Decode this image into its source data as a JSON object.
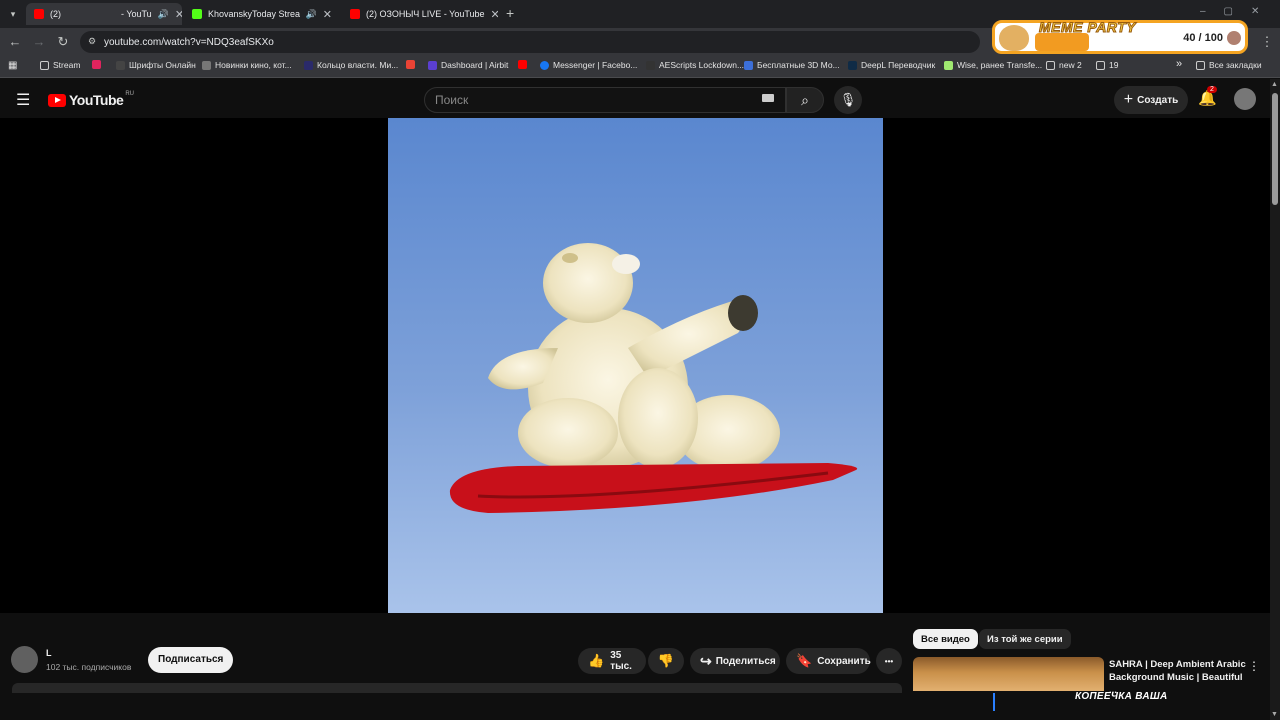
{
  "browser": {
    "tabs": [
      {
        "label": "(2)",
        "label2": "- YouTu",
        "color": "#ff0000",
        "active": true
      },
      {
        "label": "KhovanskyToday Stream - V",
        "color": "#53fc18",
        "active": false
      },
      {
        "label": "(2) ОЗОНЫЧ LIVE - YouTube",
        "color": "#ff0000",
        "active": false
      }
    ],
    "new_tab": "+",
    "url": "youtube.com/watch?v=NDQ3eafSKXo",
    "bookmarks": [
      {
        "label": "Stream",
        "icon": "folder-icon"
      },
      {
        "label": "",
        "icon": "live-icon"
      },
      {
        "label": "Шрифты Онлайн",
        "icon": "font-icon"
      },
      {
        "label": "Новинки кино, кот...",
        "icon": "film-icon"
      },
      {
        "label": "Кольцо власти. Ми...",
        "icon": "r-icon"
      },
      {
        "label": "",
        "icon": "gmail-icon"
      },
      {
        "label": "Dashboard | Airbit",
        "icon": "airbit-icon"
      },
      {
        "label": "",
        "icon": "youtube-icon"
      },
      {
        "label": "Messenger | Facebo...",
        "icon": "facebook-icon"
      },
      {
        "label": "AEScripts Lockdown...",
        "icon": "ae-icon"
      },
      {
        "label": "Бесплатные 3D Мо...",
        "icon": "3d-icon"
      },
      {
        "label": "DeepL Переводчик",
        "icon": "deepl-icon"
      },
      {
        "label": "Wise, ранее Transfe...",
        "icon": "wise-icon"
      },
      {
        "label": "new 2",
        "icon": "folder-icon"
      },
      {
        "label": "19",
        "icon": "folder-icon"
      }
    ],
    "bookmarks_more": "»",
    "all_bookmarks": "Все закладки"
  },
  "meme_widget": {
    "title": "MEME PARTY",
    "count": "40 / 100",
    "progress": 0.4
  },
  "youtube": {
    "logo_text": "YouTube",
    "logo_region": "RU",
    "search_placeholder": "Поиск",
    "create_label": "Создать",
    "notification_count": "2"
  },
  "channel": {
    "name": "L",
    "subscribers": "102 тыс. подписчиков",
    "subscribe_label": "Подписаться"
  },
  "actions": {
    "likes": "35 тыс.",
    "share": "Поделиться",
    "save": "Сохранить",
    "more": "•••"
  },
  "sidebar": {
    "chips": [
      "Все видео",
      "Из той же серии"
    ],
    "rec_title": "SAHRA | Deep Ambient Arabic Background Music | Beautiful ...",
    "overlay_text": "КОПЕЕЧКА ВАША"
  },
  "colors": {
    "youtube_red": "#ff0000",
    "meme_orange": "#f29b21",
    "sky_blue": "#6f96d6",
    "snowboard_red": "#c8101a"
  }
}
